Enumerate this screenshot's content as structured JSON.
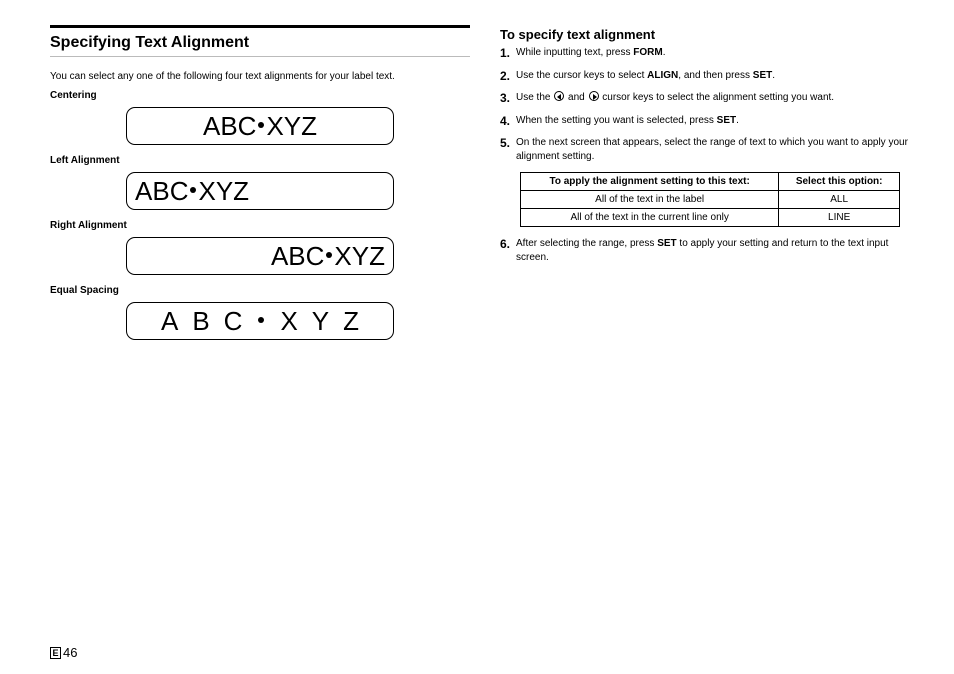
{
  "left": {
    "title": "Specifying Text Alignment",
    "intro": "You can select any one of the following four text alignments for your label text.",
    "samples": [
      {
        "label": "Centering",
        "align": "center",
        "glyphs": [
          "A",
          "B",
          "C",
          "·",
          "X",
          "Y",
          "Z"
        ],
        "spacing": "normal"
      },
      {
        "label": "Left Alignment",
        "align": "left-a",
        "glyphs": [
          "A",
          "B",
          "C",
          "·",
          "X",
          "Y",
          "Z"
        ],
        "spacing": "normal"
      },
      {
        "label": "Right Alignment",
        "align": "right-a",
        "glyphs": [
          "A",
          "B",
          "C",
          "·",
          "X",
          "Y",
          "Z"
        ],
        "spacing": "normal"
      },
      {
        "label": "Equal Spacing",
        "align": "equal",
        "glyphs": [
          "A",
          "B",
          "C",
          "·",
          "X",
          "Y",
          "Z"
        ],
        "spacing": "equal"
      }
    ]
  },
  "right": {
    "title": "To specify text alignment",
    "steps": [
      {
        "n": "1.",
        "parts": [
          {
            "t": "While inputting text, press "
          },
          {
            "t": "FORM",
            "b": true
          },
          {
            "t": "."
          }
        ]
      },
      {
        "n": "2.",
        "parts": [
          {
            "t": "Use the cursor keys to select "
          },
          {
            "t": "ALIGN",
            "b": true
          },
          {
            "t": ", and then press "
          },
          {
            "t": "SET",
            "b": true
          },
          {
            "t": "."
          }
        ]
      },
      {
        "n": "3.",
        "parts": [
          {
            "t": "Use the "
          },
          {
            "icon": "left"
          },
          {
            "t": " and "
          },
          {
            "icon": "right"
          },
          {
            "t": " cursor keys to select the alignment setting you want."
          }
        ]
      },
      {
        "n": "4.",
        "parts": [
          {
            "t": "When the setting you want is selected, press "
          },
          {
            "t": "SET",
            "b": true
          },
          {
            "t": "."
          }
        ]
      },
      {
        "n": "5.",
        "parts": [
          {
            "t": "On the next screen that appears, select the range of text to which you want to apply your alignment setting."
          }
        ],
        "table": true
      },
      {
        "n": "6.",
        "parts": [
          {
            "t": "After selecting the range, press "
          },
          {
            "t": "SET",
            "b": true
          },
          {
            "t": " to apply your setting and return to the text input screen."
          }
        ]
      }
    ],
    "table": {
      "head": [
        "To apply the alignment  setting to this text:",
        "Select this option:"
      ],
      "rows": [
        [
          "All of the text in the label",
          "ALL"
        ],
        [
          "All of the text in the current line only",
          "LINE"
        ]
      ]
    }
  },
  "footer": {
    "lang": "E",
    "page": "46"
  }
}
